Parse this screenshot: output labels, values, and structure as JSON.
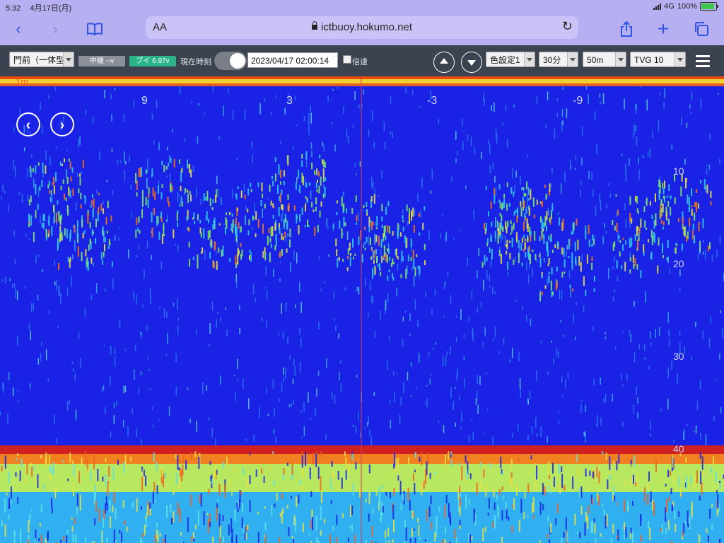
{
  "status": {
    "time": "5:32",
    "date": "4月17日(月)",
    "network": "4G",
    "battery": "100%"
  },
  "safari": {
    "text_size": "AA",
    "url": "ictbuoy.hokumo.net"
  },
  "toolbar": {
    "location": "門前（一体型",
    "relay_badge": "中継 --v",
    "buoy_badge": "ブイ 6.97v",
    "current_time_label": "現在時刻",
    "datetime": "2023/04/17 02:00:14",
    "speed_label": "倍速",
    "color_setting": "色設定1",
    "interval": "30分",
    "range": "50m",
    "tvg": "TVG 10"
  },
  "echogram": {
    "top_label": "1m",
    "time_ticks": [
      "9",
      "3",
      "-3",
      "-9"
    ],
    "depth_ticks": [
      "10",
      "20",
      "30",
      "40"
    ]
  }
}
